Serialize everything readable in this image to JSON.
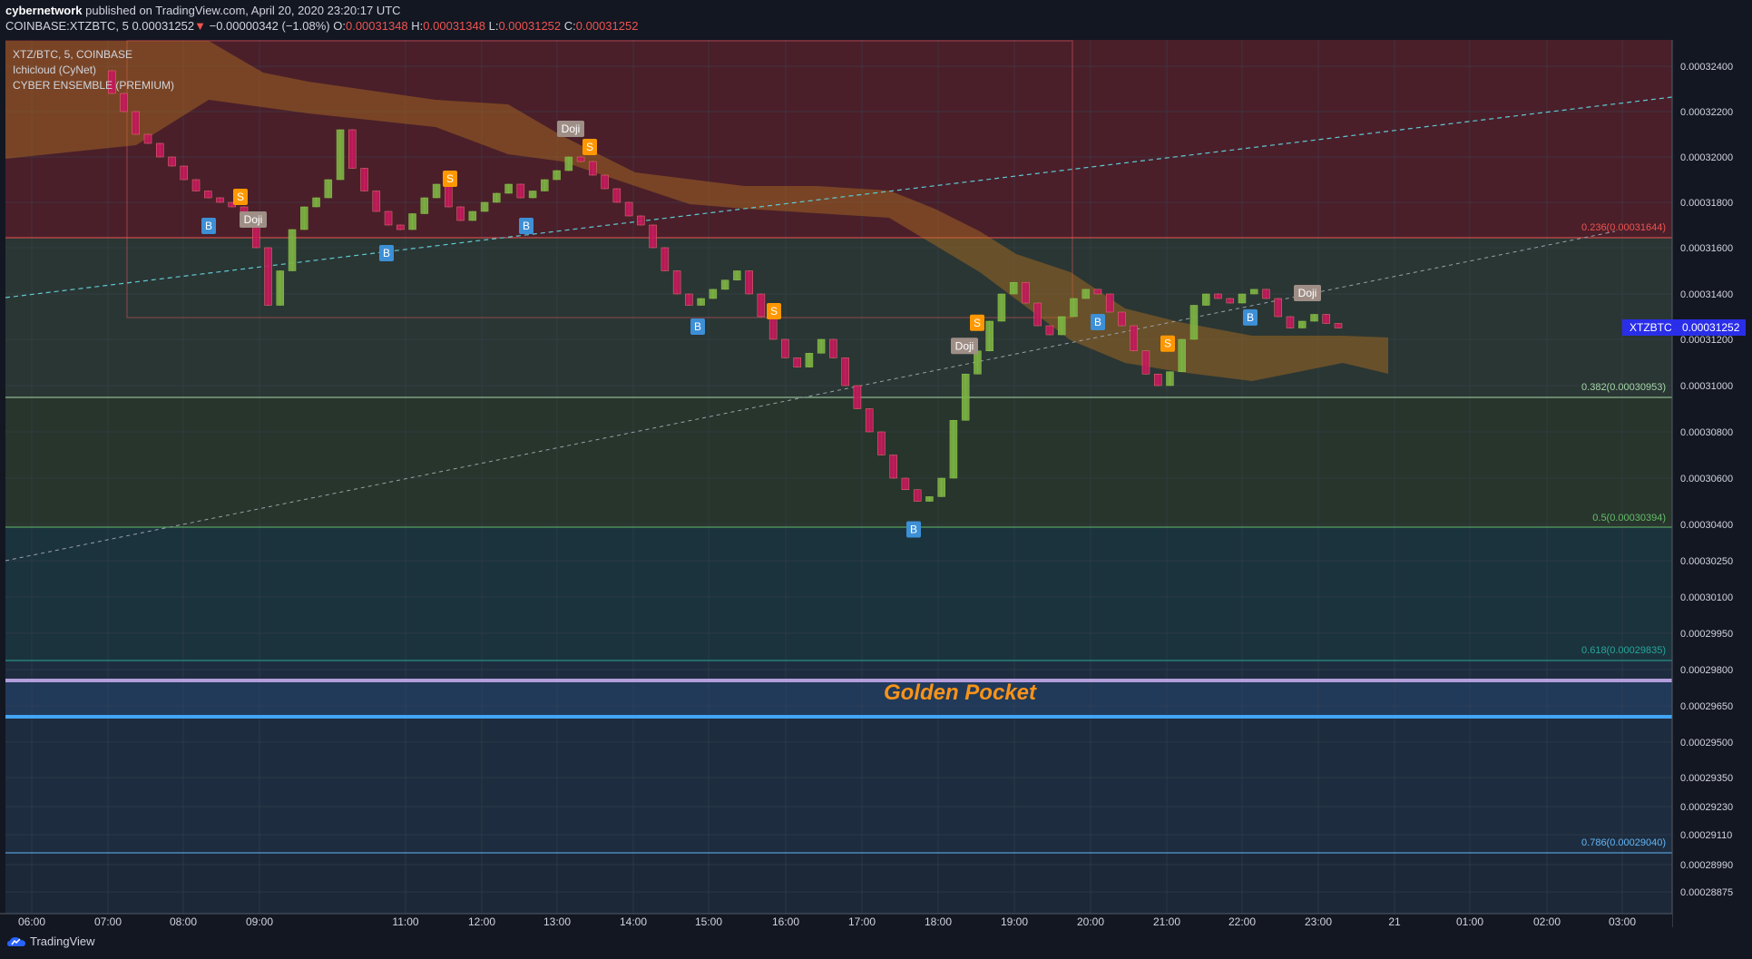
{
  "header": {
    "author": "cybernetwork",
    "published": "published on TradingView.com, April 20, 2020 23:20:17 UTC",
    "symbol_line": "COINBASE:XTZBTC, 5",
    "last": "0.00031252",
    "change_arrow": "▼",
    "change": "−0.00000342 (−1.08%)",
    "o_label": "O:",
    "o": "0.00031348",
    "h_label": "H:",
    "h": "0.00031348",
    "l_label": "L:",
    "l": "0.00031252",
    "c_label": "C:",
    "c": "0.00031252"
  },
  "legend": [
    "XTZ/BTC, 5, COINBASE",
    "Ichicloud (CyNet)",
    "CYBER ENSEMBLE (PREMIUM)"
  ],
  "price_tag": {
    "symbol": "XTZBTC",
    "value": "0.00031252"
  },
  "footer": {
    "brand": "TradingView"
  },
  "colors": {
    "background": "#131722",
    "up": "#26a69a",
    "down": "#ef5350",
    "golden_pocket": "#f7931a",
    "gp_upper_line": "#b39ddb",
    "gp_lower_line": "#42a5f5",
    "sell_badge": "#ff9800",
    "buy_badge": "#3d8fd6",
    "doji_badge": "#9e8e86"
  },
  "chart_data": {
    "type": "candlestick",
    "x_axis_ticks": [
      "06:00",
      "07:00",
      "08:00",
      "09:00",
      "11:00",
      "12:00",
      "13:00",
      "14:00",
      "15:00",
      "16:00",
      "17:00",
      "18:00",
      "19:00",
      "20:00",
      "21:00",
      "22:00",
      "23:00",
      "21",
      "01:00",
      "02:00",
      "03:00"
    ],
    "y_axis_ticks": [
      "0.00032400",
      "0.00032200",
      "0.00032000",
      "0.00031800",
      "0.00031600",
      "0.00031400",
      "0.00031200",
      "0.00031000",
      "0.00030800",
      "0.00030600",
      "0.00030400",
      "0.00030250",
      "0.00030100",
      "0.00029950",
      "0.00029800",
      "0.00029650",
      "0.00029500",
      "0.00029350",
      "0.00029230",
      "0.00029110",
      "0.00028990",
      "0.00028875"
    ],
    "fib_levels": [
      {
        "label": "0.236(0.00031644)",
        "color": "#ef5350"
      },
      {
        "label": "0.382(0.00030953)",
        "color": "#a5d6a7"
      },
      {
        "label": "0.5(0.00030394)",
        "color": "#66bb6a"
      },
      {
        "label": "0.618(0.00029835)",
        "color": "#26a69a"
      },
      {
        "label": "0.786(0.00029040)",
        "color": "#64b5f6"
      }
    ],
    "annotation": "Golden Pocket",
    "price_path": [
      0.0003238,
      0.0003228,
      0.000322,
      0.000321,
      0.0003206,
      0.00032,
      0.0003196,
      0.000319,
      0.0003185,
      0.0003182,
      0.000318,
      0.0003178,
      0.000317,
      0.000316,
      0.0003135,
      0.000315,
      0.0003168,
      0.0003178,
      0.0003182,
      0.000319,
      0.0003212,
      0.0003195,
      0.0003185,
      0.0003176,
      0.000317,
      0.0003168,
      0.0003175,
      0.0003182,
      0.0003188,
      0.0003178,
      0.0003172,
      0.0003176,
      0.000318,
      0.0003184,
      0.0003188,
      0.0003182,
      0.0003185,
      0.000319,
      0.0003194,
      0.00032,
      0.0003198,
      0.0003192,
      0.0003186,
      0.000318,
      0.0003174,
      0.000317,
      0.000316,
      0.000315,
      0.000314,
      0.0003135,
      0.0003138,
      0.0003142,
      0.0003146,
      0.000315,
      0.000314,
      0.000313,
      0.000312,
      0.0003112,
      0.0003108,
      0.0003114,
      0.000312,
      0.0003112,
      0.00031,
      0.000309,
      0.000308,
      0.000307,
      0.000306,
      0.0003055,
      0.000305,
      0.0003052,
      0.000306,
      0.0003085,
      0.0003105,
      0.0003115,
      0.0003128,
      0.000314,
      0.0003145,
      0.0003136,
      0.0003126,
      0.0003122,
      0.000313,
      0.0003138,
      0.0003142,
      0.000314,
      0.0003132,
      0.0003126,
      0.0003115,
      0.0003105,
      0.00031,
      0.0003106,
      0.000312,
      0.0003135,
      0.000314,
      0.0003138,
      0.0003136,
      0.000314,
      0.0003142,
      0.0003138,
      0.000313,
      0.0003125,
      0.0003128,
      0.0003131,
      0.0003127,
      0.0003125
    ],
    "signals": [
      {
        "type": "B",
        "time": "08:25"
      },
      {
        "type": "S",
        "time": "08:50"
      },
      {
        "type": "Doji",
        "time": "09:00"
      },
      {
        "type": "B",
        "time": "10:45"
      },
      {
        "type": "S",
        "time": "11:35"
      },
      {
        "type": "B",
        "time": "12:35"
      },
      {
        "type": "Doji",
        "time": "13:10"
      },
      {
        "type": "S",
        "time": "13:25"
      },
      {
        "type": "B",
        "time": "14:50"
      },
      {
        "type": "S",
        "time": "15:50"
      },
      {
        "type": "B",
        "time": "17:40"
      },
      {
        "type": "Doji",
        "time": "18:20"
      },
      {
        "type": "S",
        "time": "18:30"
      },
      {
        "type": "B",
        "time": "20:05"
      },
      {
        "type": "S",
        "time": "21:00"
      },
      {
        "type": "B",
        "time": "22:05"
      },
      {
        "type": "Doji",
        "time": "22:50"
      }
    ]
  }
}
